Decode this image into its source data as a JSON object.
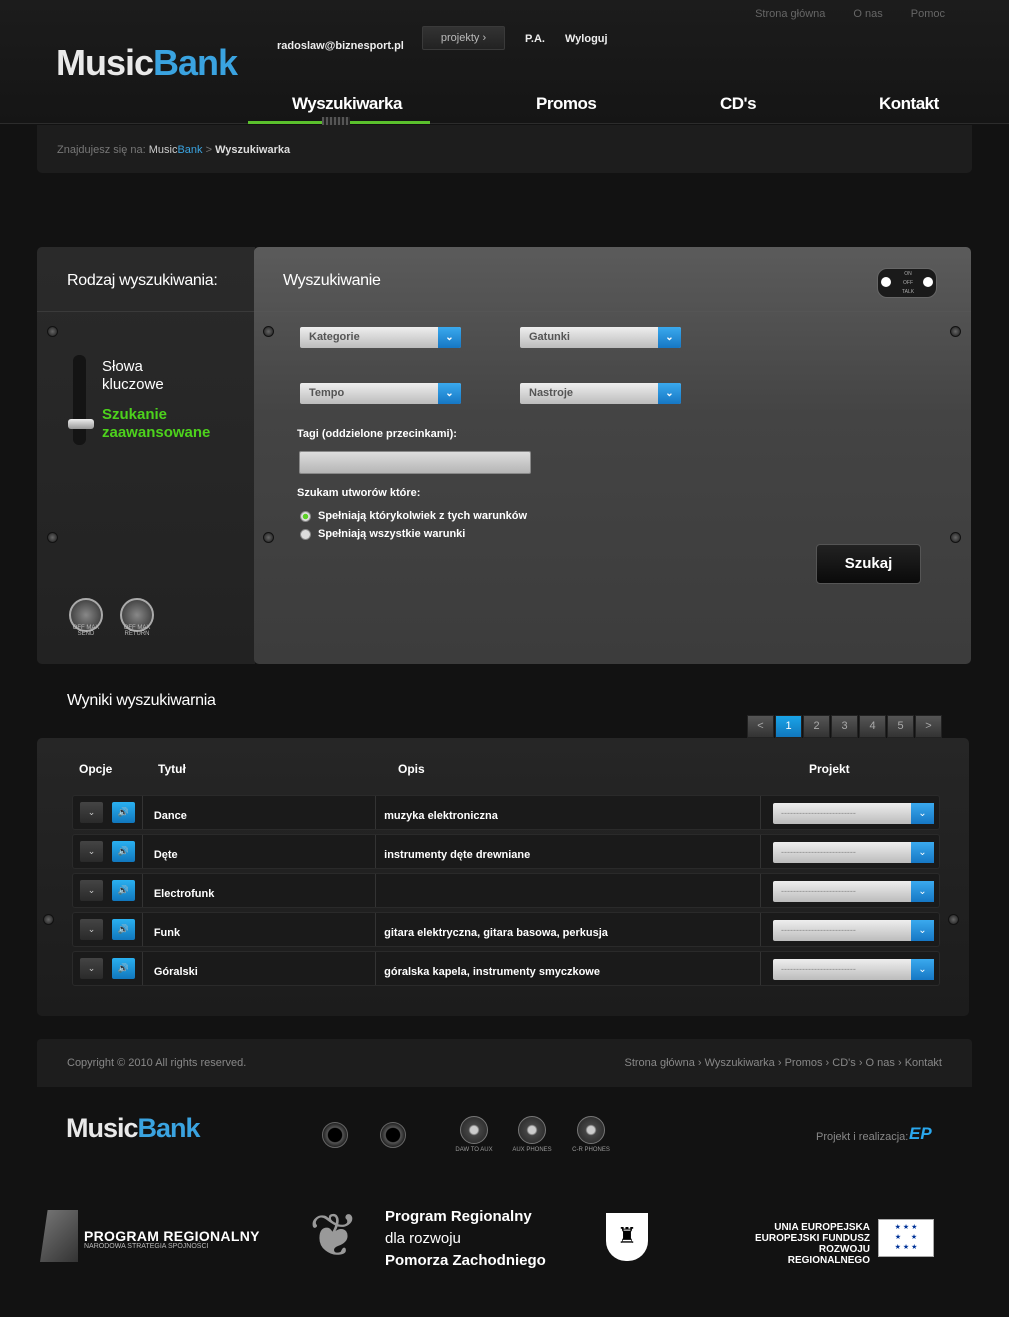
{
  "header": {
    "top_links": [
      "Strona główna",
      "O nas",
      "Pomoc"
    ],
    "logo": {
      "part1": "Music",
      "part2": "Bank"
    },
    "user_email": "radoslaw@biznesport.pl",
    "projects_button": "projekty ›",
    "pa_label": "P.A.",
    "logout_label": "Wyloguj",
    "nav": [
      "Wyszukiwarka",
      "Promos",
      "CD's",
      "Kontakt"
    ],
    "accent_color": "#5bc02d",
    "brand_color": "#3aa3e0"
  },
  "breadcrumb": {
    "prefix": "Znajdujesz się na:",
    "home1": "Music",
    "home2": "Bank",
    "separator": ">",
    "current": "Wyszukiwarka"
  },
  "search_type": {
    "title": "Rodzaj wyszukiwania:",
    "option1": "Słowa kluczowe",
    "option2": "Szukanie zaawansowane",
    "knob1": {
      "min": "OFF",
      "max": "MAX",
      "label": "SEND"
    },
    "knob2": {
      "min": "OFF",
      "max": "MAX",
      "label": "RETURN"
    }
  },
  "search": {
    "title": "Wyszukiwanie",
    "switch_labels": [
      "ON",
      "OFF",
      "TALK"
    ],
    "selects": [
      "Kategorie",
      "Gatunki",
      "Tempo",
      "Nastroje"
    ],
    "tags_label": "Tagi (oddzielone przecinkami):",
    "tags_value": "",
    "condition_label": "Szukam utworów które:",
    "radio1": "Spełniają którykolwiek z tych warunków",
    "radio2": "Spełniają wszystkie warunki",
    "selected_radio": 1,
    "submit": "Szukaj"
  },
  "results": {
    "title": "Wyniki wyszukiwarnia",
    "pagination": {
      "prev": "<",
      "pages": [
        "1",
        "2",
        "3",
        "4",
        "5"
      ],
      "next": ">",
      "current": "1"
    },
    "columns": [
      "Opcje",
      "Tytuł",
      "Opis",
      "Projekt"
    ],
    "project_placeholder": "-------------------------",
    "rows": [
      {
        "title": "Dance",
        "desc": "muzyka elektroniczna"
      },
      {
        "title": "Dęte",
        "desc": "instrumenty dęte drewniane"
      },
      {
        "title": "Electrofunk",
        "desc": ""
      },
      {
        "title": "Funk",
        "desc": "gitara elektryczna, gitara basowa, perkusja"
      },
      {
        "title": "Góralski",
        "desc": "góralska kapela, instrumenty smyczkowe"
      }
    ]
  },
  "footer": {
    "copyright": "Copyright © 2010 All rights reserved.",
    "links": [
      "Strona główna",
      "Wyszukiwarka",
      "Promos",
      "CD's",
      "O nas",
      "Kontakt"
    ],
    "logo": {
      "part1": "Music",
      "part2": "Bank"
    },
    "knobs": [
      {
        "label": "DAW TO AUX"
      },
      {
        "label": "AUX PHONES"
      },
      {
        "label": "C-R PHONES"
      }
    ],
    "realization_label": "Projekt i realizacja:",
    "realization_logo": "EP"
  },
  "eu": {
    "program": "PROGRAM REGIONALNY",
    "program_sub": "NARODOWA STRATEGIA SPÓJNOŚCI",
    "regional_line1": "Program Regionalny",
    "regional_line2": "dla rozwoju",
    "regional_line3": "Pomorza Zachodniego",
    "fund_line1": "UNIA EUROPEJSKA",
    "fund_line2": "EUROPEJSKI FUNDUSZ",
    "fund_line3": "ROZWOJU REGIONALNEGO"
  }
}
